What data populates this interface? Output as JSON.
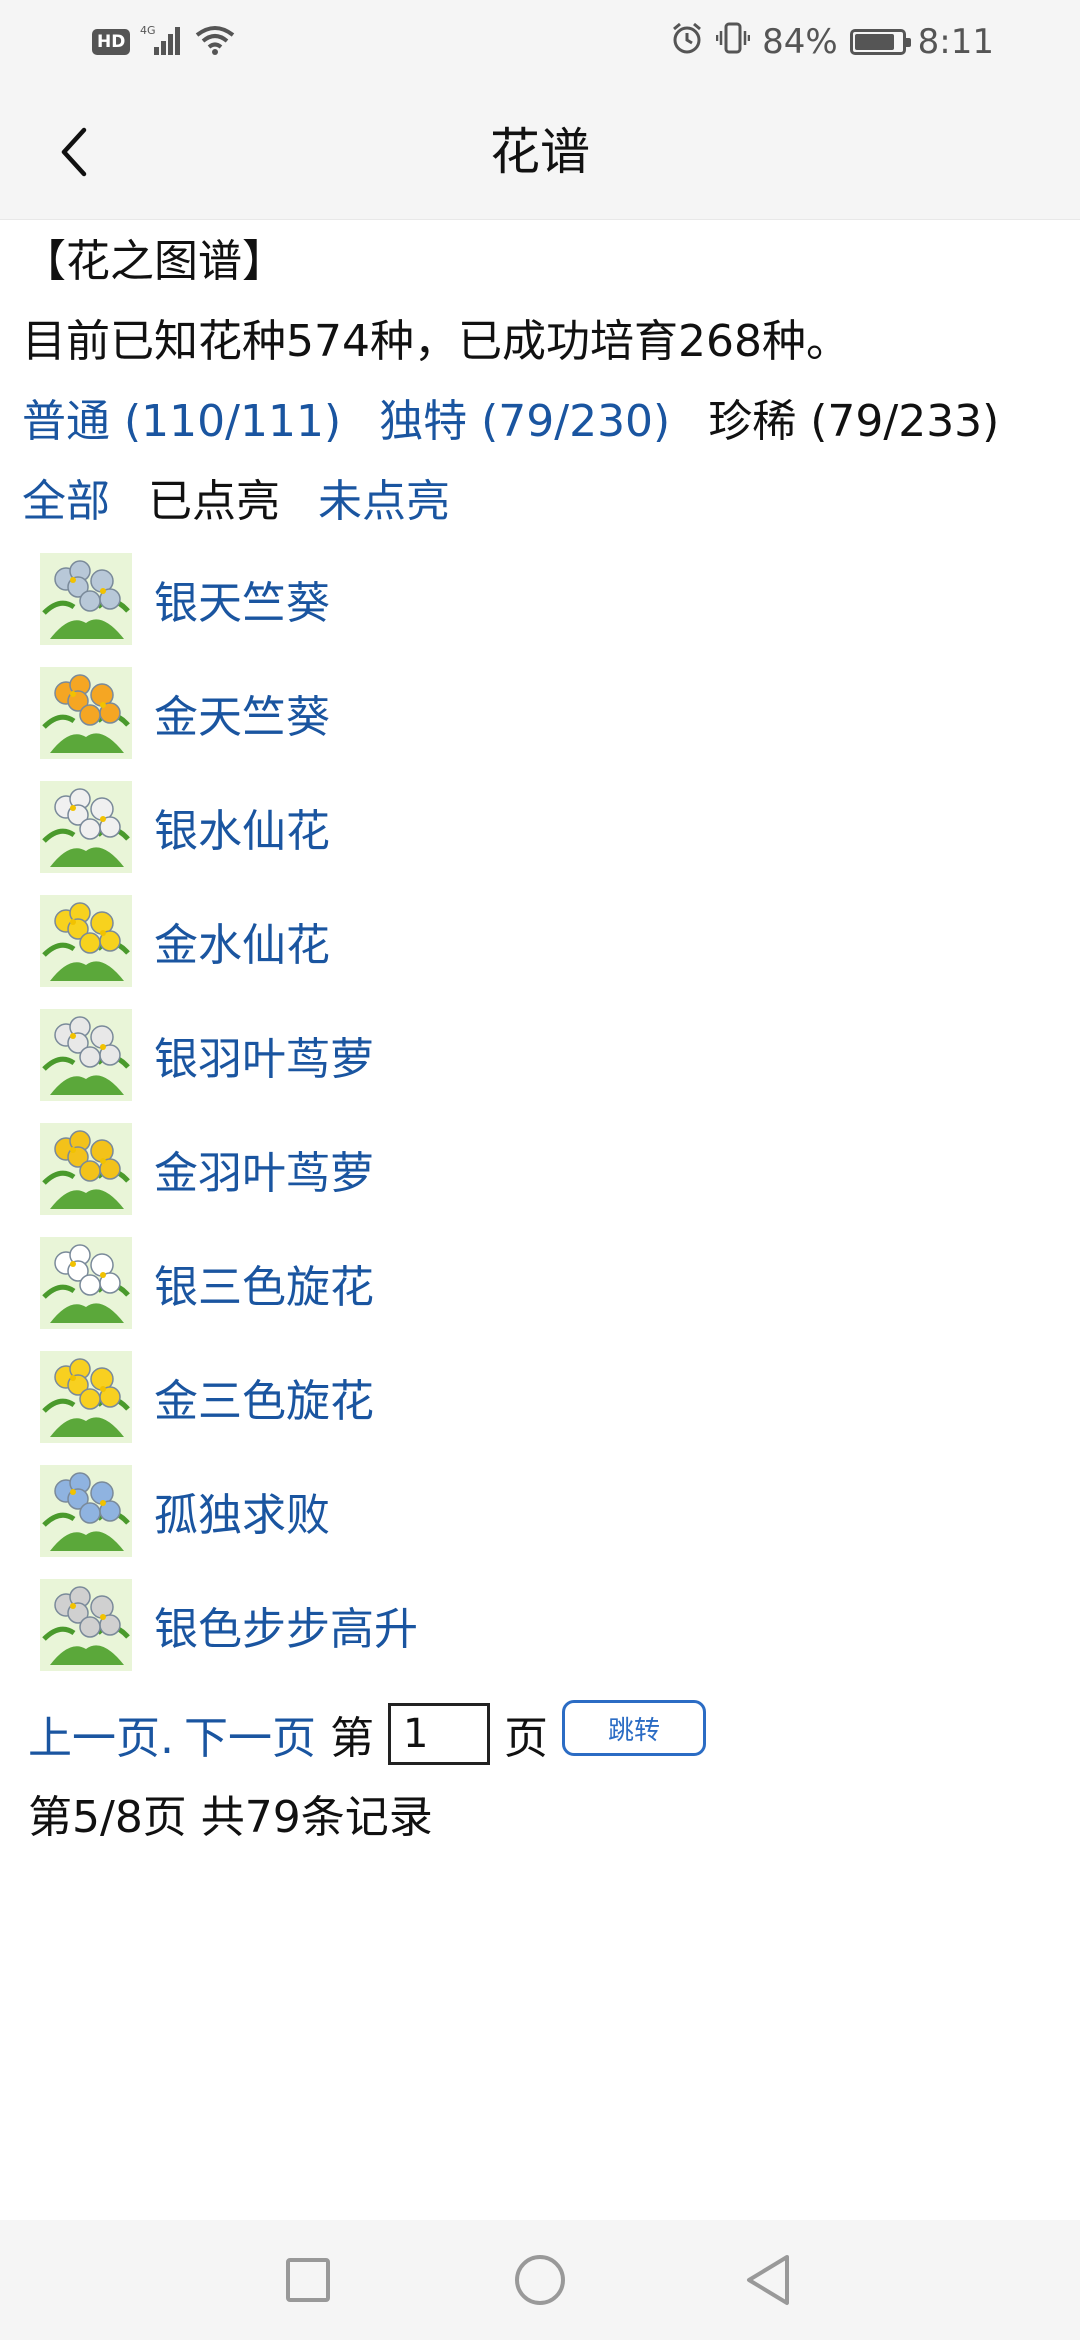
{
  "status": {
    "hd": "HD",
    "network": "4G",
    "battery_percent": "84%",
    "battery_level": 0.84,
    "time": "8:11"
  },
  "header": {
    "title": "花谱"
  },
  "main": {
    "section_title": "【花之图谱】",
    "summary": "目前已知花种574种，已成功培育268种。",
    "rarity_tabs": [
      {
        "label": "普通 (110/111)"
      },
      {
        "label": "独特 (79/230)"
      },
      {
        "label": "珍稀 (79/233)"
      }
    ],
    "filter_tabs": [
      {
        "label": "全部"
      },
      {
        "label": "已点亮"
      },
      {
        "label": "未点亮"
      }
    ],
    "flowers": [
      {
        "name": "银天竺葵",
        "icon": "silver-geranium-icon",
        "color": "#b8c8d8"
      },
      {
        "name": "金天竺葵",
        "icon": "gold-geranium-icon",
        "color": "#f5a623"
      },
      {
        "name": "银水仙花",
        "icon": "silver-narcissus-icon",
        "color": "#f0f0f0"
      },
      {
        "name": "金水仙花",
        "icon": "gold-narcissus-icon",
        "color": "#f7d21e"
      },
      {
        "name": "银羽叶茑萝",
        "icon": "silver-cypress-vine-icon",
        "color": "#e8e8e8"
      },
      {
        "name": "金羽叶茑萝",
        "icon": "gold-cypress-vine-icon",
        "color": "#f3c21a"
      },
      {
        "name": "银三色旋花",
        "icon": "silver-morning-glory-icon",
        "color": "#ffffff"
      },
      {
        "name": "金三色旋花",
        "icon": "gold-morning-glory-icon",
        "color": "#f8d020"
      },
      {
        "name": "孤独求败",
        "icon": "lonely-undefeated-flower-icon",
        "color": "#8fb3e0"
      },
      {
        "name": "银色步步高升",
        "icon": "silver-rising-flower-icon",
        "color": "#d0d0d0"
      }
    ],
    "pager": {
      "prev": "上一页.",
      "next": "下一页",
      "page_prefix": "第",
      "page_input_value": "1",
      "page_suffix": "页",
      "jump": "跳转"
    },
    "record_info": "第5/8页 共79条记录"
  },
  "colors": {
    "link": "#1a55a0",
    "bar_bg": "#f5f5f5",
    "button_border": "#2b6cc4"
  }
}
